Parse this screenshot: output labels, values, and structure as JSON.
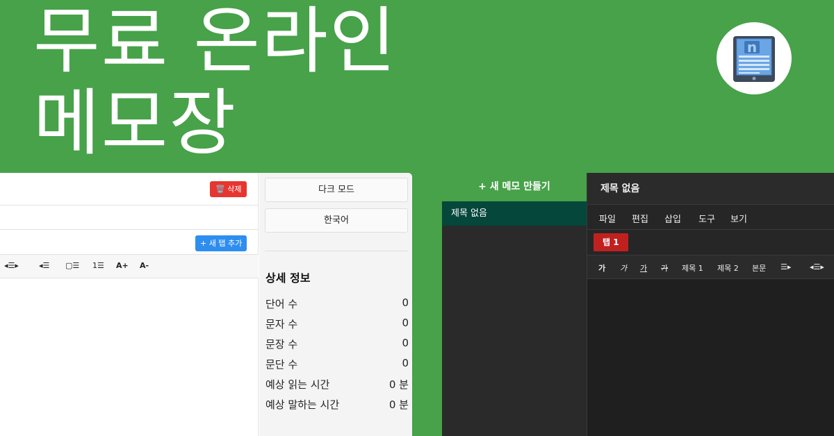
{
  "hero": {
    "line1": "무료 온라인",
    "line2": "메모장"
  },
  "logo": {
    "icon": "notepad-book-icon",
    "letter": "n"
  },
  "light_editor": {
    "delete_label": "🗑️ 삭제",
    "new_tab_label": "+ 새 탭 추가",
    "toolbar": [
      "◂☰▸",
      "◂☰",
      "▢☰",
      "1☰",
      "A+",
      "A-"
    ]
  },
  "sidebar": {
    "dark_mode_label": "다크 모드",
    "language_label": "한국어",
    "details_title": "상세 정보",
    "stats": [
      {
        "label": "단어 수",
        "value": "0"
      },
      {
        "label": "문자 수",
        "value": "0"
      },
      {
        "label": "문장 수",
        "value": "0"
      },
      {
        "label": "문단 수",
        "value": "0"
      },
      {
        "label": "예상 읽는 시간",
        "value": "0 분"
      },
      {
        "label": "예상 말하는 시간",
        "value": "0 분"
      }
    ]
  },
  "dark_app": {
    "new_memo_label": "+ 새 메모 만들기",
    "memo_item": "제목 없음",
    "title": "제목 없음",
    "menu": [
      "파일",
      "편집",
      "삽입",
      "도구",
      "보기"
    ],
    "tab_label": "탭 1",
    "toolbar": [
      "가",
      "가",
      "가",
      "가",
      "제목 1",
      "제목 2",
      "본문",
      "☰▸",
      "◂☰▸"
    ]
  },
  "colors": {
    "background": "#47a249",
    "delete": "#e7352f",
    "new_tab": "#2e8ef0",
    "memo_selected": "#05473b",
    "dark_tab": "#c0211f"
  }
}
